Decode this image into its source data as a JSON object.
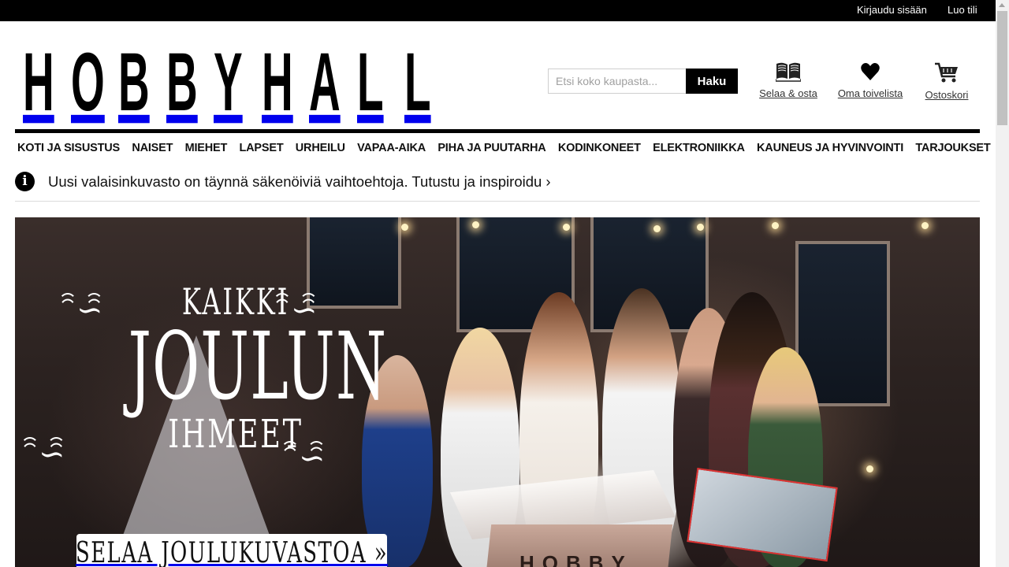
{
  "topbar": {
    "login": "Kirjaudu sisään",
    "create_account": "Luo tili"
  },
  "brand": {
    "logo_text": "HOBBYHALL"
  },
  "search": {
    "placeholder": "Etsi koko kaupasta...",
    "value": "",
    "button": "Haku"
  },
  "header_actions": {
    "browse": {
      "label": "Selaa & osta",
      "icon": "open-book-icon"
    },
    "wishlist": {
      "label": "Oma toivelista",
      "icon": "heart-icon"
    },
    "cart": {
      "label": "Ostoskori",
      "icon": "shopping-cart-icon"
    }
  },
  "nav": {
    "items": [
      "KOTI JA SISUSTUS",
      "NAISET",
      "MIEHET",
      "LAPSET",
      "URHEILU",
      "VAPAA-AIKA",
      "PIHA JA PUUTARHA",
      "KODINKONEET",
      "ELEKTRONIIKKA",
      "KAUNEUS JA HYVINVOINTI",
      "TARJOUKSET"
    ]
  },
  "notice": {
    "icon": "info-icon",
    "text": "Uusi valaisinkuvasto on täynnä säkenöiviä vaihtoehtoja. Tutustu ja inspiroidu ›"
  },
  "hero": {
    "line1": "KAIKKI",
    "line2": "JOULUN",
    "line3": "IHMEET",
    "cta": "SELAA JOULUKUVASTOA »",
    "chest_label": "HOBBY"
  },
  "colors": {
    "topbar": "#000000",
    "accent": "#000000",
    "text": "#111111"
  }
}
